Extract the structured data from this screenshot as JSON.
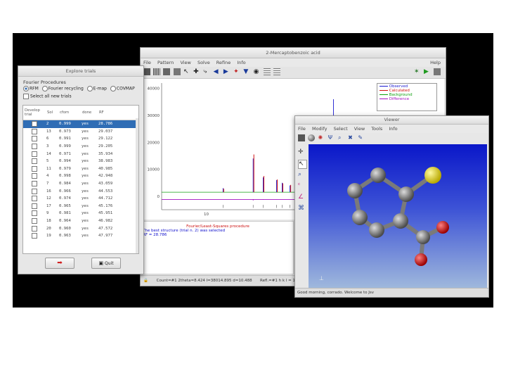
{
  "main": {
    "title": "2-Mercaptobenzoic acid",
    "menu": [
      "File",
      "Pattern",
      "View",
      "Solve",
      "Refine",
      "Info"
    ],
    "help": "Help",
    "legend": [
      {
        "label": "Observed",
        "color": "#1a1ad0"
      },
      {
        "label": "Calculated",
        "color": "#d01010"
      },
      {
        "label": "Background",
        "color": "#10a010"
      },
      {
        "label": "Difference",
        "color": "#a010c0"
      }
    ],
    "messages": [
      {
        "text": "Fourier/Least-Squares procedure",
        "color": "#cc1010"
      },
      {
        "text": "The best structure (trial n. 2) was selected",
        "color": "#1010cc"
      },
      {
        "text": "RF = 28.786",
        "color": "#1010cc"
      }
    ],
    "status": "Count=#1 2theta=8.424 I=38014.895 d=10.488",
    "status_right": "Refl.=#1 h k l = 1 0"
  },
  "chart_data": {
    "type": "line",
    "xlabel": "",
    "ylabel": "",
    "y_ticks": [
      "40000",
      "30000",
      "20000",
      "10000",
      "0"
    ],
    "x_ticks": [
      "10",
      "20",
      "30"
    ],
    "ylim": [
      -5000,
      42000
    ],
    "xlim": [
      6,
      31
    ],
    "peaks_x": [
      11.5,
      14.2,
      15.1,
      16.3,
      16.8,
      17.5,
      19.2,
      21.4,
      22.1,
      23.3,
      24.0,
      25.6,
      26.4,
      27.8,
      28.5,
      29.8
    ],
    "series": [
      {
        "name": "Observed",
        "color": "#1a1ad0",
        "values": [
          3000,
          14000,
          7000,
          6000,
          5000,
          4000,
          9500,
          36000,
          12000,
          8500,
          7000,
          10500,
          6000,
          5500,
          4000,
          3500
        ]
      },
      {
        "name": "Calculated",
        "color": "#d01010",
        "values": [
          2800,
          15500,
          7500,
          6200,
          4800,
          4200,
          9000,
          22000,
          11000,
          9500,
          7500,
          10000,
          6500,
          5000,
          4200,
          3200
        ]
      }
    ],
    "grid": false
  },
  "explore": {
    "title": "Explore trials",
    "procedures_label": "Fourier Procedures",
    "radio": [
      "RFM",
      "Fourier recycling",
      "E-map",
      "COVMAP"
    ],
    "select_all": "Select all new trials",
    "columns": [
      "Develop trial",
      "Sol",
      "cfom",
      "done",
      "RF"
    ],
    "rows": [
      [
        "2",
        "0.999",
        "yes",
        "28.786"
      ],
      [
        "13",
        "0.973",
        "yes",
        "29.037"
      ],
      [
        "6",
        "0.991",
        "yes",
        "29.122"
      ],
      [
        "3",
        "0.999",
        "yes",
        "29.205"
      ],
      [
        "14",
        "0.971",
        "yes",
        "35.934"
      ],
      [
        "5",
        "0.994",
        "yes",
        "38.983"
      ],
      [
        "11",
        "0.979",
        "yes",
        "40.985"
      ],
      [
        "4",
        "0.998",
        "yes",
        "42.948"
      ],
      [
        "7",
        "0.984",
        "yes",
        "43.059"
      ],
      [
        "16",
        "0.966",
        "yes",
        "44.553"
      ],
      [
        "12",
        "0.974",
        "yes",
        "44.712"
      ],
      [
        "17",
        "0.965",
        "yes",
        "45.176"
      ],
      [
        "9",
        "0.981",
        "yes",
        "45.951"
      ],
      [
        "18",
        "0.964",
        "yes",
        "46.982"
      ],
      [
        "20",
        "0.960",
        "yes",
        "47.572"
      ],
      [
        "19",
        "0.963",
        "yes",
        "47.977"
      ]
    ],
    "selected_index": 0,
    "quit": "Quit"
  },
  "viewer": {
    "title": "Viewer",
    "menu": [
      "File",
      "Modify",
      "Select",
      "View",
      "Tools",
      "Info"
    ],
    "status": "Good morning, corrado. Welcome to Jsv"
  }
}
